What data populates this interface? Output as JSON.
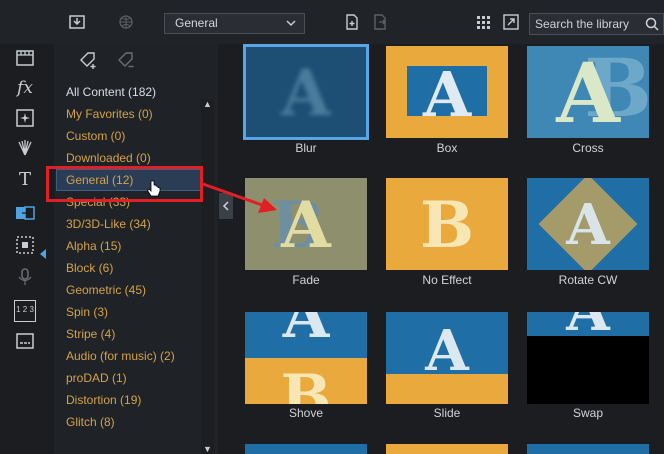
{
  "toolbar": {
    "dropdown_value": "General",
    "search_placeholder": "Search the library",
    "icons": [
      "import-icon",
      "globe-icon",
      "add-new-icon",
      "export-icon",
      "grid-view-icon",
      "expand-icon",
      "search-icon"
    ]
  },
  "leftbar": {
    "icons": [
      "media-icon",
      "fx-icon",
      "particle-icon",
      "magic-icon",
      "title-icon",
      "transition-icon",
      "pip-icon",
      "audio-icon",
      "chapter-icon",
      "subtitle-icon"
    ],
    "fx_label": "fx",
    "title_label": "T",
    "chapter_label": "1 2 3"
  },
  "categories": {
    "items": [
      {
        "label": "All Content (182)"
      },
      {
        "label": "My Favorites  (0)"
      },
      {
        "label": "Custom  (0)"
      },
      {
        "label": "Downloaded  (0)"
      },
      {
        "label": "General  (12)"
      },
      {
        "label": "Special  (33)"
      },
      {
        "label": "3D/3D-Like  (34)"
      },
      {
        "label": "Alpha  (15)"
      },
      {
        "label": "Block  (6)"
      },
      {
        "label": "Geometric  (45)"
      },
      {
        "label": "Spin  (3)"
      },
      {
        "label": "Stripe  (4)"
      },
      {
        "label": "Audio (for music)  (2)"
      },
      {
        "label": "proDAD  (1)"
      },
      {
        "label": "Distortion  (19)"
      },
      {
        "label": "Glitch  (8)"
      }
    ],
    "selected": "General  (12)"
  },
  "transitions": [
    {
      "name": "Blur"
    },
    {
      "name": "Box"
    },
    {
      "name": "Cross"
    },
    {
      "name": "Fade"
    },
    {
      "name": "No Effect"
    },
    {
      "name": "Rotate CW"
    },
    {
      "name": "Shove"
    },
    {
      "name": "Slide"
    },
    {
      "name": "Swap"
    }
  ],
  "thumb_letters": {
    "a": "A",
    "b": "B"
  },
  "colors": {
    "accent": "#58a6e6",
    "annotation_red": "#e11f25",
    "category_text": "#d4a24a",
    "thumb_orange": "#e9a93d",
    "thumb_blue": "#1f6ea6"
  }
}
